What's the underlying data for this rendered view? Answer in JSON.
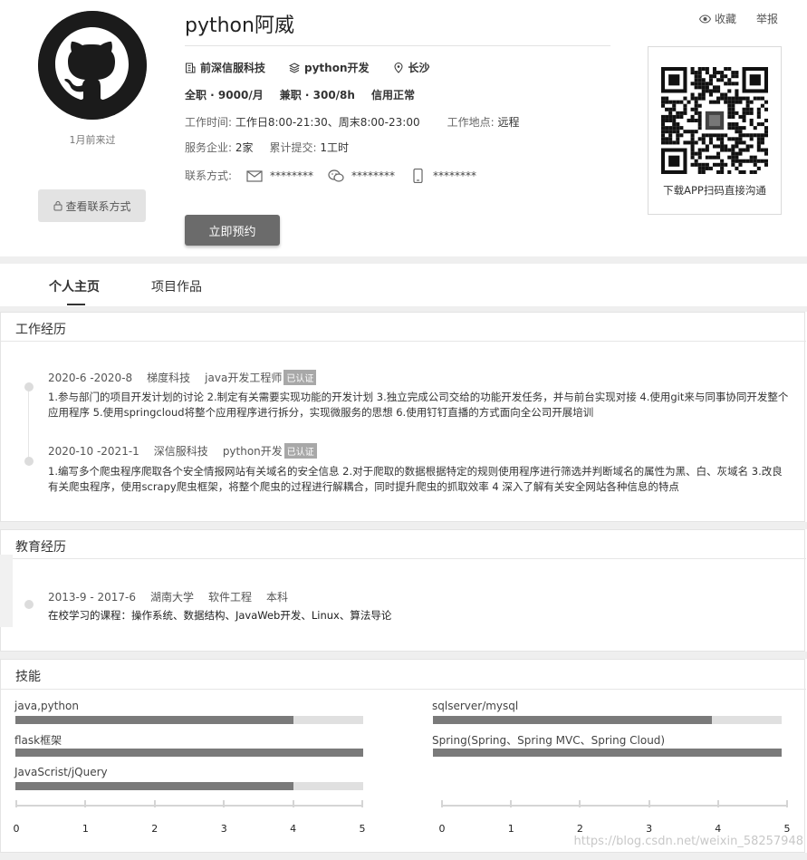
{
  "profile": {
    "name": "python阿威",
    "last_visit": "1月前来过",
    "view_contact_label": "查看联系方式",
    "company": "前深信服科技",
    "role": "python开发",
    "city": "长沙",
    "fulltime": "全职 · 9000/月",
    "parttime": "兼职 · 300/8h",
    "credit": "信用正常",
    "work_time_label": "工作时间:",
    "work_time_value": "工作日8:00-21:30、周末8:00-23:00",
    "work_place_label": "工作地点:",
    "work_place_value": "远程",
    "served_label": "服务企业:",
    "served_value": "2家",
    "submitted_label": "累计提交:",
    "submitted_value": "1工时",
    "contact_label": "联系方式:",
    "email_mask": "********",
    "wechat_mask": "********",
    "phone_mask": "********",
    "book_button": "立即预约"
  },
  "header_actions": {
    "favorite": "收藏",
    "report": "举报"
  },
  "qr": {
    "caption": "下载APP扫码直接沟通"
  },
  "tabs": [
    {
      "label": "个人主页",
      "active": true
    },
    {
      "label": "项目作品",
      "active": false
    }
  ],
  "work": {
    "title": "工作经历",
    "entries": [
      {
        "period": "2020-6 -2020-8",
        "company": "梯度科技",
        "role": "java开发工程师",
        "badge": "已认证",
        "desc": "1.参与部门的项目开发计划的讨论 2.制定有关需要实现功能的开发计划 3.独立完成公司交给的功能开发任务，并与前台实现对接 4.使用git来与同事协同开发整个应用程序 5.使用springcloud将整个应用程序进行拆分，实现微服务的思想 6.使用钉钉直播的方式面向全公司开展培训"
      },
      {
        "period": "2020-10 -2021-1",
        "company": "深信服科技",
        "role": "python开发",
        "badge": "已认证",
        "desc": "1.编写多个爬虫程序爬取各个安全情报网站有关域名的安全信息 2.对于爬取的数据根据特定的规则使用程序进行筛选并判断域名的属性为黑、白、灰域名 3.改良有关爬虫程序，使用scrapy爬虫框架，将整个爬虫的过程进行解耦合，同时提升爬虫的抓取效率 4 深入了解有关安全网站各种信息的特点"
      }
    ]
  },
  "education": {
    "title": "教育经历",
    "entry": {
      "period": "2013-9 - 2017-6",
      "school": "湖南大学",
      "major": "软件工程",
      "degree": "本科",
      "desc": "在校学习的课程：操作系统、数据结构、JavaWeb开发、Linux、算法导论"
    }
  },
  "skills": {
    "title": "技能",
    "scale_max": 5,
    "left": [
      {
        "name": "java,python",
        "level": 4
      },
      {
        "name": "flask框架",
        "level": 5
      },
      {
        "name": "JavaScrist/jQuery",
        "level": 4
      }
    ],
    "right": [
      {
        "name": "sqlserver/mysql",
        "level": 4
      },
      {
        "name": "Spring(Spring、Spring MVC、Spring Cloud)",
        "level": 5
      }
    ],
    "axis_ticks": [
      "0",
      "1",
      "2",
      "3",
      "4",
      "5"
    ]
  },
  "watermark": "https://blog.csdn.net/weixin_58257948",
  "colors": {
    "accent_dark": "#6b6b6b",
    "bar_fill": "#7a7a7a",
    "bar_track": "#e0e0e0",
    "badge": "#a8a8a8"
  }
}
